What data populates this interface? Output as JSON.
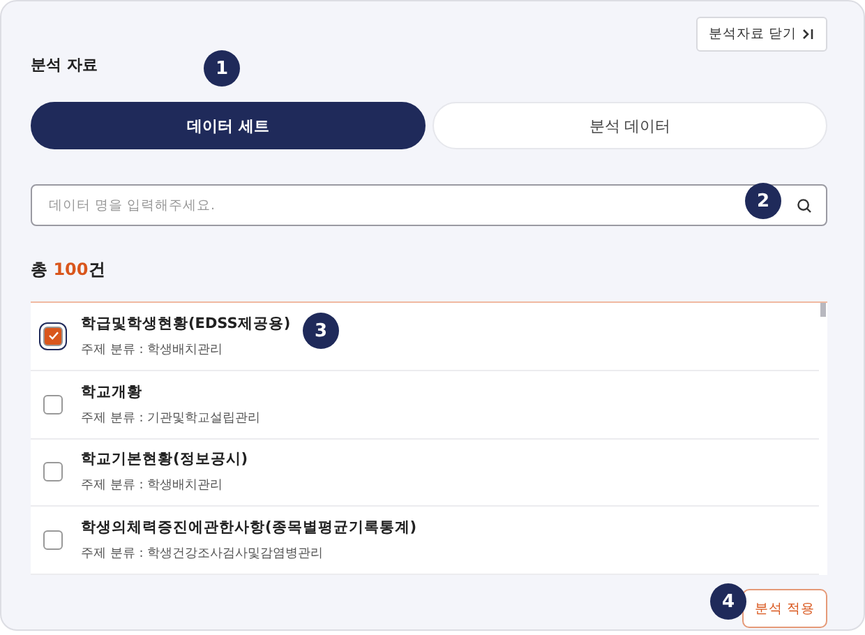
{
  "close_button": {
    "label": "분석자료 닫기"
  },
  "title": "분석 자료",
  "tabs": [
    {
      "label": "데이터 세트",
      "selected": true
    },
    {
      "label": "분석 데이터",
      "selected": false
    }
  ],
  "search": {
    "placeholder": "데이터 명을 입력해주세요."
  },
  "total": {
    "prefix": "총 ",
    "number": "100",
    "suffix": "건"
  },
  "items": [
    {
      "name": "학급및학생현황(EDSS제공용)",
      "category": "주제 분류 : 학생배치관리",
      "checked": true
    },
    {
      "name": "학교개황",
      "category": "주제 분류 : 기관및학교설립관리",
      "checked": false
    },
    {
      "name": "학교기본현황(정보공시)",
      "category": "주제 분류 : 학생배치관리",
      "checked": false
    },
    {
      "name": "학생의체력증진에관한사항(종목별평균기록통계)",
      "category": "주제 분류 : 학생건강조사검사및감염병관리",
      "checked": false
    }
  ],
  "apply_button": {
    "label": "분석 적용"
  },
  "callouts": [
    "1",
    "2",
    "3",
    "4"
  ]
}
